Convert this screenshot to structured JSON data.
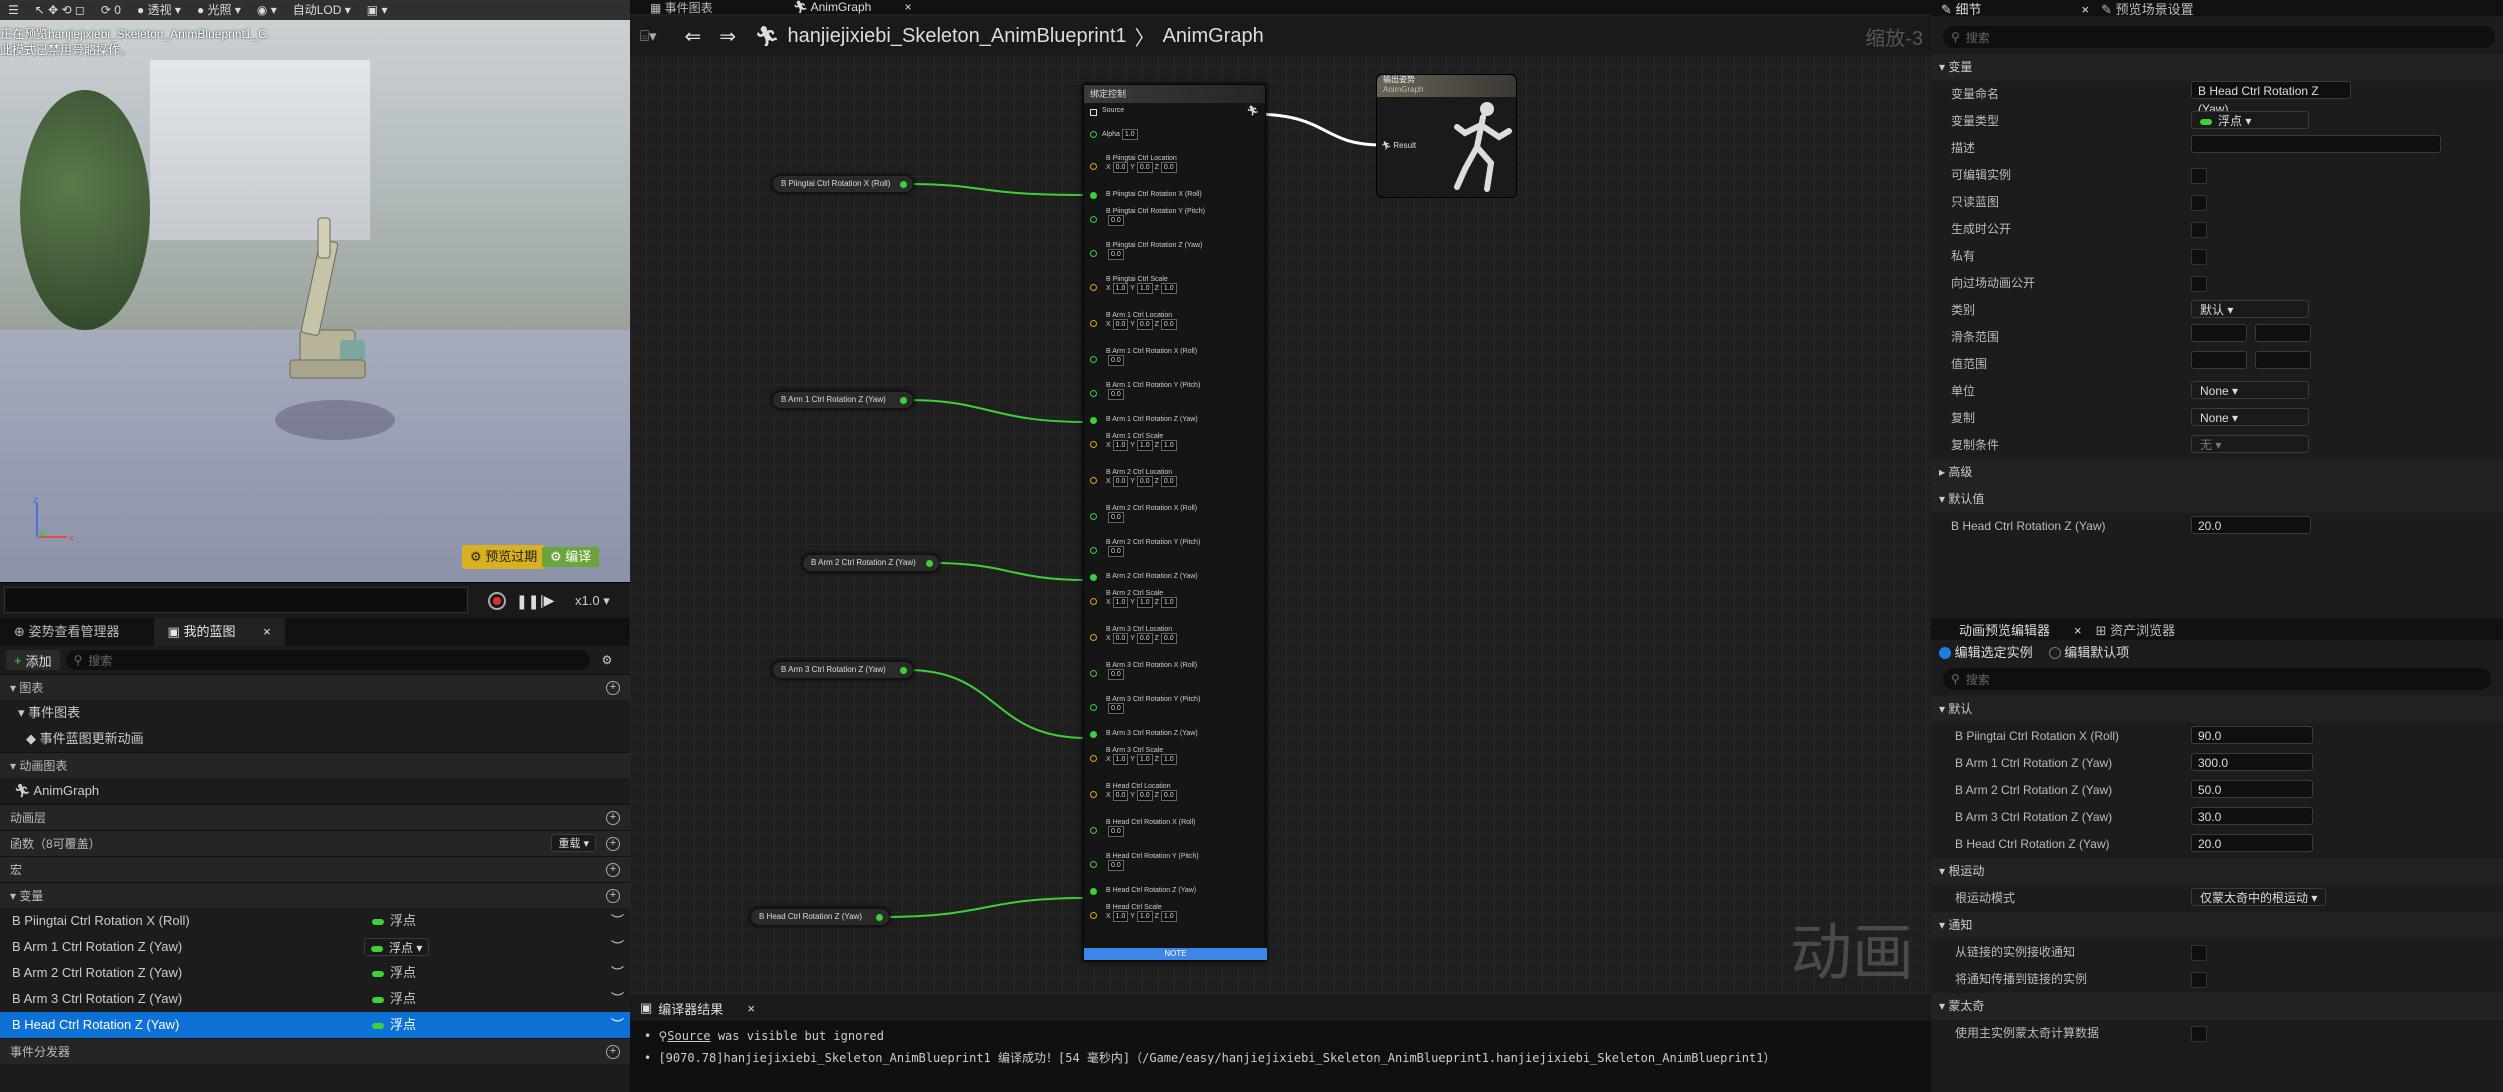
{
  "viewport": {
    "toolbar": [
      "透视",
      "光照",
      "自动LOD"
    ],
    "preview_text": [
      "正在预览hanjiejixiebi_Skeleton_AnimBlueprint1_C.",
      "此模式已禁用骨骼操作。"
    ],
    "warn_label": "预览过期",
    "compile_label": "编译",
    "speed": "x1.0"
  },
  "left_panel": {
    "tabs": [
      "姿势查看管理器",
      "我的蓝图"
    ],
    "add_label": "添加",
    "search_placeholder": "搜索",
    "sections": {
      "graphs": "图表",
      "event_graph": "事件图表",
      "event_update": "事件蓝图更新动画",
      "anim_graphs": "动画图表",
      "anim_graph": "AnimGraph",
      "anim_layers": "动画层",
      "functions": "函数（8可覆盖）",
      "override": "重载",
      "macros": "宏",
      "variables": "变量",
      "dispatchers": "事件分发器"
    },
    "variables": [
      {
        "name": "B Piingtai Ctrl Rotation X (Roll)",
        "type": "浮点"
      },
      {
        "name": "B Arm 1 Ctrl Rotation Z (Yaw)",
        "type": "浮点"
      },
      {
        "name": "B Arm 2 Ctrl Rotation Z (Yaw)",
        "type": "浮点"
      },
      {
        "name": "B Arm 3 Ctrl Rotation Z (Yaw)",
        "type": "浮点"
      },
      {
        "name": "B Head Ctrl Rotation Z (Yaw)",
        "type": "浮点"
      }
    ]
  },
  "graph": {
    "tabs": [
      "事件图表",
      "AnimGraph"
    ],
    "breadcrumb_bp": "hanjiejixiebi_Skeleton_AnimBlueprint1",
    "breadcrumb_graph": "AnimGraph",
    "zoom": "缩放-3",
    "watermark": "动画",
    "var_nodes": [
      "B Piingtai Ctrl Rotation X (Roll)",
      "B Arm 1 Ctrl Rotation Z (Yaw)",
      "B Arm 2 Ctrl Rotation Z (Yaw)",
      "B Arm 3 Ctrl Rotation Z (Yaw)",
      "B Head Ctrl Rotation Z (Yaw)"
    ],
    "control_node": {
      "title": "绑定控制",
      "source": "Source",
      "alpha_label": "Alpha",
      "alpha": "1.0",
      "note": "NOTE"
    },
    "output_node": {
      "title": "输出姿势",
      "subtitle": "AnimGraph",
      "pin": "Result"
    }
  },
  "compiler": {
    "tab": "编译器结果",
    "line1_link": "Source",
    "line1_rest": " was visible but ignored",
    "line2": "[9070.78]hanjiejixiebi_Skeleton_AnimBlueprint1 编译成功！[54 毫秒内]（/Game/easy/hanjiejixiebi_Skeleton_AnimBlueprint1.hanjiejixiebi_Skeleton_AnimBlueprint1）"
  },
  "details": {
    "tabs": [
      "细节",
      "预览场景设置"
    ],
    "search_placeholder": "搜索",
    "section": "变量",
    "rows": [
      {
        "label": "变量命名",
        "value": "B Head Ctrl Rotation Z (Yaw)"
      },
      {
        "label": "变量类型",
        "value": "浮点"
      },
      {
        "label": "描述",
        "value": ""
      },
      {
        "label": "可编辑实例",
        "value": ""
      },
      {
        "label": "只读蓝图",
        "value": ""
      },
      {
        "label": "生成时公开",
        "value": ""
      },
      {
        "label": "私有",
        "value": ""
      },
      {
        "label": "向过场动画公开",
        "value": ""
      },
      {
        "label": "类别",
        "value": "默认"
      },
      {
        "label": "滑条范围",
        "value": ""
      },
      {
        "label": "值范围",
        "value": ""
      },
      {
        "label": "单位",
        "value": "None"
      },
      {
        "label": "复制",
        "value": "None"
      },
      {
        "label": "复制条件",
        "value": "无"
      }
    ],
    "advanced": "高级",
    "default_section": "默认值",
    "default_label": "B Head Ctrl Rotation Z (Yaw)",
    "default_value": "20.0"
  },
  "anim_preview": {
    "tabs": [
      "动画预览编辑器",
      "资产浏览器"
    ],
    "radio_selected": "编辑选定实例",
    "radio_default": "编辑默认项",
    "search_placeholder": "搜索",
    "default_section": "默认",
    "values": [
      {
        "label": "B Piingtai Ctrl Rotation X (Roll)",
        "value": "90.0"
      },
      {
        "label": "B Arm 1 Ctrl Rotation Z (Yaw)",
        "value": "300.0"
      },
      {
        "label": "B Arm 2 Ctrl Rotation Z (Yaw)",
        "value": "50.0"
      },
      {
        "label": "B Arm 3 Ctrl Rotation Z (Yaw)",
        "value": "30.0"
      },
      {
        "label": "B Head Ctrl Rotation Z (Yaw)",
        "value": "20.0"
      }
    ],
    "root_motion_section": "根运动",
    "root_motion_label": "根运动模式",
    "root_motion_value": "仅蒙太奇中的根运动",
    "notify_section": "通知",
    "notify_rows": [
      "从链接的实例接收通知",
      "将通知传播到链接的实例"
    ],
    "montage_section": "蒙太奇",
    "montage_row": "使用主实例蒙太奇计算数据"
  }
}
